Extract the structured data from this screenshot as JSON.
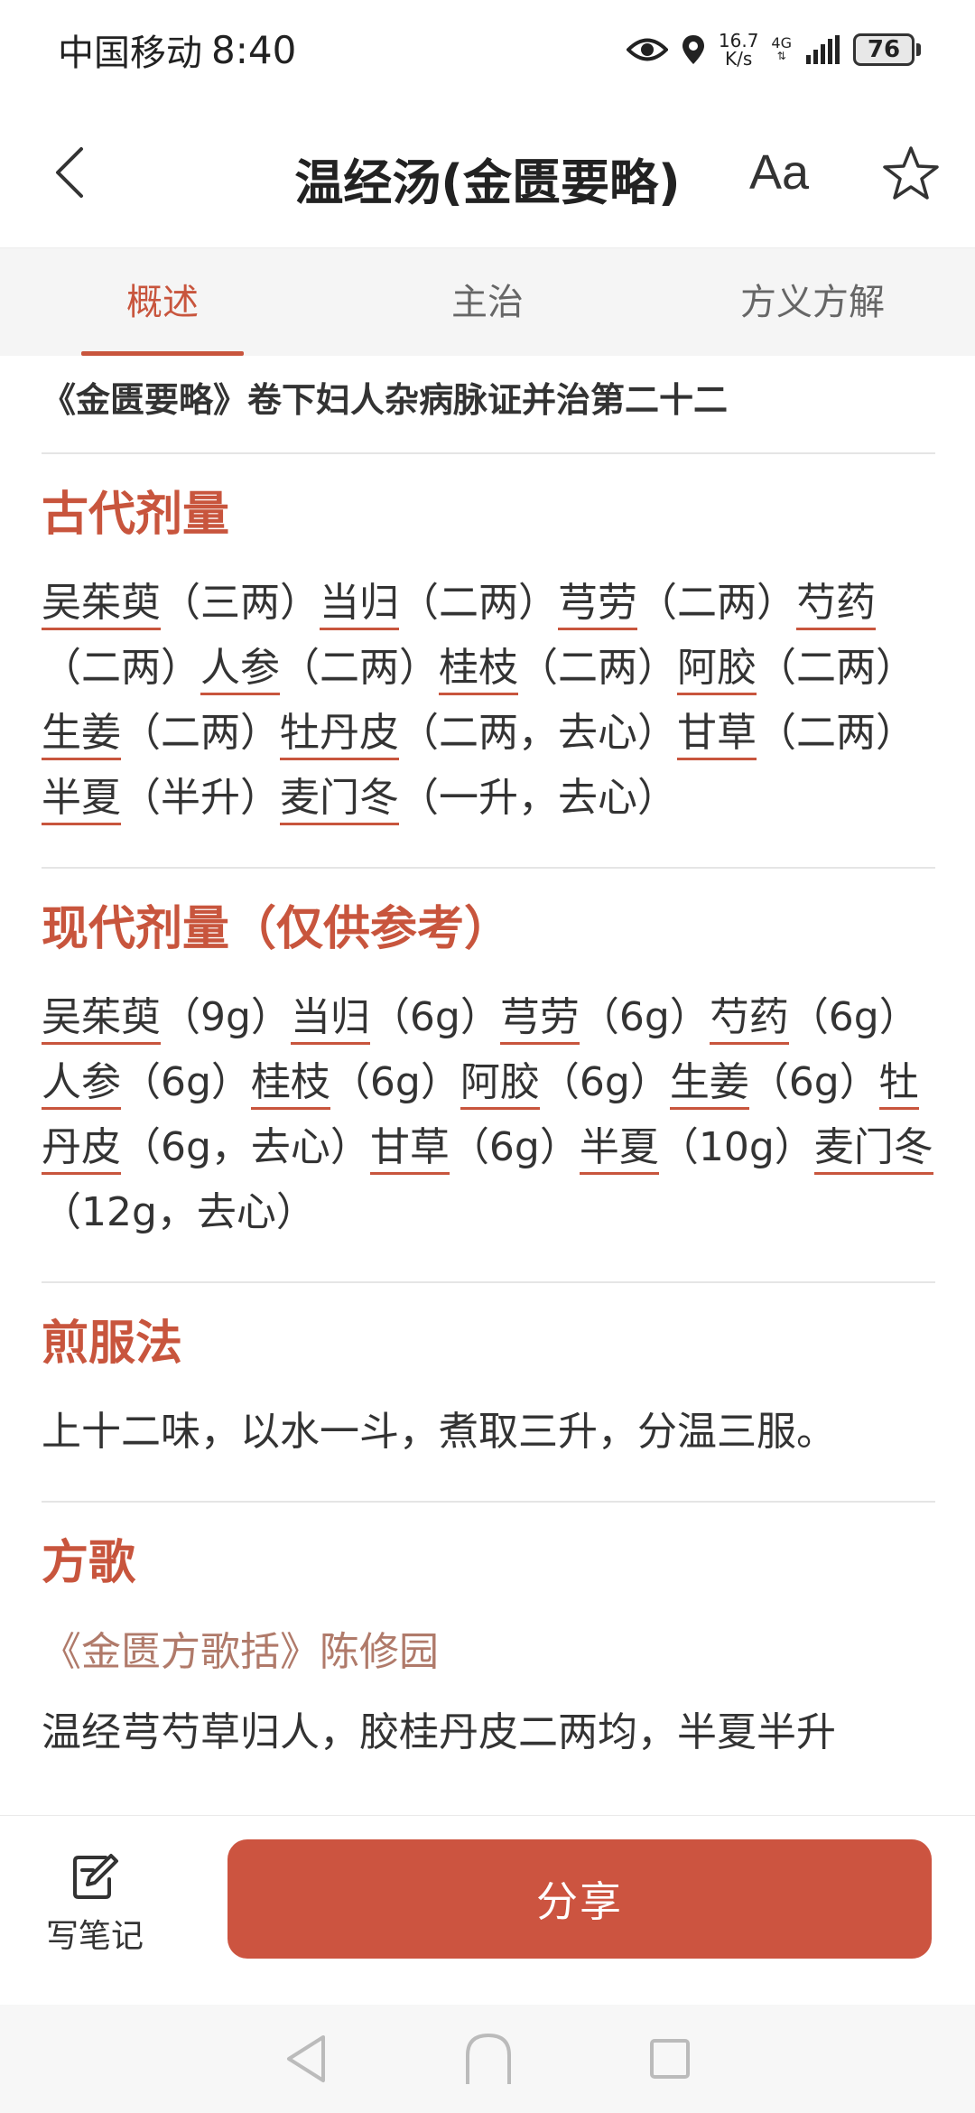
{
  "status_bar": {
    "carrier": "中国移动",
    "time": "8:40",
    "net_speed_value": "16.7",
    "net_speed_unit": "K/s",
    "network": "4G",
    "battery": "76"
  },
  "header": {
    "title": "温经汤(金匮要略)",
    "font_label": "Aa"
  },
  "tabs": [
    {
      "label": "概述",
      "active": true
    },
    {
      "label": "主治",
      "active": false
    },
    {
      "label": "方义方解",
      "active": false
    }
  ],
  "source": "《金匮要略》卷下妇人杂病脉证并治第二十二",
  "ancient_dosage": {
    "title": "古代剂量",
    "items": [
      {
        "herb": "吴茱萸",
        "dose": "（三两）"
      },
      {
        "herb": "当归",
        "dose": "（二两）"
      },
      {
        "herb": "芎劳",
        "dose": "（二两）"
      },
      {
        "herb": "芍药",
        "dose": "（二两）"
      },
      {
        "herb": "人参",
        "dose": "（二两）"
      },
      {
        "herb": "桂枝",
        "dose": "（二两）"
      },
      {
        "herb": "阿胶",
        "dose": "（二两）"
      },
      {
        "herb": "生姜",
        "dose": "（二两）"
      },
      {
        "herb": "牡丹皮",
        "dose": "（二两，去心）"
      },
      {
        "herb": "甘草",
        "dose": "（二两）"
      },
      {
        "herb": "半夏",
        "dose": "（半升）"
      },
      {
        "herb": "麦门冬",
        "dose": "（一升，去心）"
      }
    ]
  },
  "modern_dosage": {
    "title": "现代剂量（仅供参考）",
    "items": [
      {
        "herb": "吴茱萸",
        "dose": "（9g）"
      },
      {
        "herb": "当归",
        "dose": "（6g）"
      },
      {
        "herb": "芎劳",
        "dose": "（6g）"
      },
      {
        "herb": "芍药",
        "dose": "（6g）"
      },
      {
        "herb": "人参",
        "dose": "（6g）"
      },
      {
        "herb": "桂枝",
        "dose": "（6g）"
      },
      {
        "herb": "阿胶",
        "dose": "（6g）"
      },
      {
        "herb": "生姜",
        "dose": "（6g）"
      },
      {
        "herb": "牡丹皮",
        "dose": "（6g，去心）"
      },
      {
        "herb": "甘草",
        "dose": "（6g）"
      },
      {
        "herb": "半夏",
        "dose": "（10g）"
      },
      {
        "herb": "麦门冬",
        "dose": "（12g，去心）"
      }
    ]
  },
  "decoction": {
    "title": "煎服法",
    "text": "上十二味，以水一斗，煮取三升，分温三服。"
  },
  "formula_song": {
    "title": "方歌",
    "author": "《金匮方歌括》陈修园",
    "text": "温经芎芍草归人，胶桂丹皮二两均，半夏半升"
  },
  "bottom_bar": {
    "note_label": "写笔记",
    "share_label": "分享"
  },
  "colors": {
    "accent": "#c8553d",
    "share_button": "#cc5440"
  }
}
